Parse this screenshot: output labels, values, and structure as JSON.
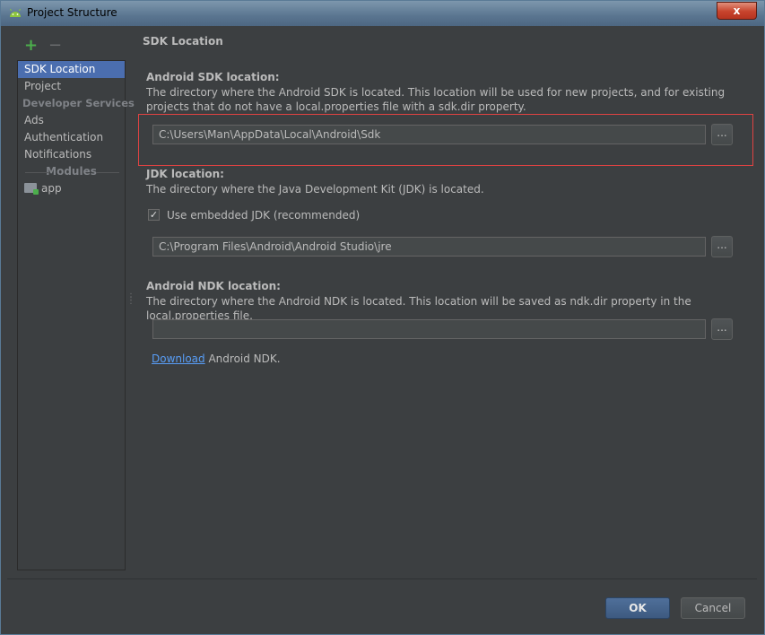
{
  "window": {
    "title": "Project Structure",
    "close_label": "x"
  },
  "toolbar": {
    "add_label": "+",
    "remove_label": "−"
  },
  "sidebar": {
    "items": [
      {
        "label": "SDK Location",
        "selected": true
      },
      {
        "label": "Project"
      }
    ],
    "group_developer_services": "Developer Services",
    "services": [
      {
        "label": "Ads"
      },
      {
        "label": "Authentication"
      },
      {
        "label": "Notifications"
      }
    ],
    "group_modules": "Modules",
    "modules": [
      {
        "label": "app",
        "icon": "folder-icon"
      }
    ]
  },
  "main": {
    "section_title": "SDK Location",
    "android_sdk": {
      "label": "Android SDK location:",
      "description": "The directory where the Android SDK is located. This location will be used for new projects, and for existing projects that do not have a local.properties file with a sdk.dir property.",
      "value": "C:\\Users\\Man\\AppData\\Local\\Android\\Sdk",
      "browse_label": "..."
    },
    "jdk": {
      "label": "JDK location:",
      "description": "The directory where the Java Development Kit (JDK) is located.",
      "checkbox_label": "Use embedded JDK (recommended)",
      "checkbox_checked": true,
      "checkbox_mark": "✓",
      "value": "C:\\Program Files\\Android\\Android Studio\\jre",
      "browse_label": "..."
    },
    "ndk": {
      "label": "Android NDK location:",
      "description": "The directory where the Android NDK is located. This location will be saved as ndk.dir property in the local.properties file.",
      "value": "",
      "browse_label": "...",
      "download_link": "Download",
      "download_suffix": " Android NDK."
    }
  },
  "buttons": {
    "ok": "OK",
    "cancel": "Cancel"
  },
  "colors": {
    "selection": "#4b6eaf",
    "highlight_border": "#e04242",
    "link": "#589df6",
    "add_icon": "#4cae4c"
  }
}
